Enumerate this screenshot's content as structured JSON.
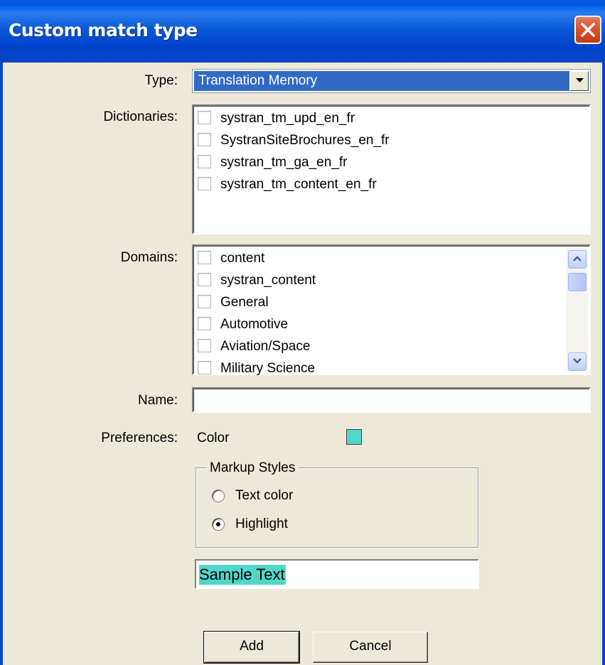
{
  "dialog": {
    "title": "Custom match type"
  },
  "type_field": {
    "label": "Type:",
    "value": "Translation Memory"
  },
  "dictionaries": {
    "label": "Dictionaries:",
    "items": [
      {
        "label": "systran_tm_upd_en_fr",
        "checked": false
      },
      {
        "label": "SystranSiteBrochures_en_fr",
        "checked": false
      },
      {
        "label": "systran_tm_ga_en_fr",
        "checked": false
      },
      {
        "label": "systran_tm_content_en_fr",
        "checked": false
      }
    ]
  },
  "domains": {
    "label": "Domains:",
    "items": [
      {
        "label": "content",
        "checked": false
      },
      {
        "label": "systran_content",
        "checked": false
      },
      {
        "label": "General",
        "checked": false
      },
      {
        "label": "Automotive",
        "checked": false
      },
      {
        "label": "Aviation/Space",
        "checked": false
      },
      {
        "label": "Military Science",
        "checked": false
      }
    ]
  },
  "name_field": {
    "label": "Name:",
    "value": ""
  },
  "preferences": {
    "label": "Preferences:",
    "color_label": "Color",
    "color_value": "#4fd8c9",
    "markup_styles": {
      "legend": "Markup Styles",
      "options": [
        {
          "label": "Text color",
          "selected": false
        },
        {
          "label": "Highlight",
          "selected": true
        }
      ]
    },
    "sample_text": "Sample Text"
  },
  "buttons": {
    "add": "Add",
    "cancel": "Cancel"
  },
  "colors": {
    "titlebar": "#0a5ad8",
    "selection": "#316ac5",
    "highlight": "#4fd8c9",
    "face": "#ece9d8"
  }
}
